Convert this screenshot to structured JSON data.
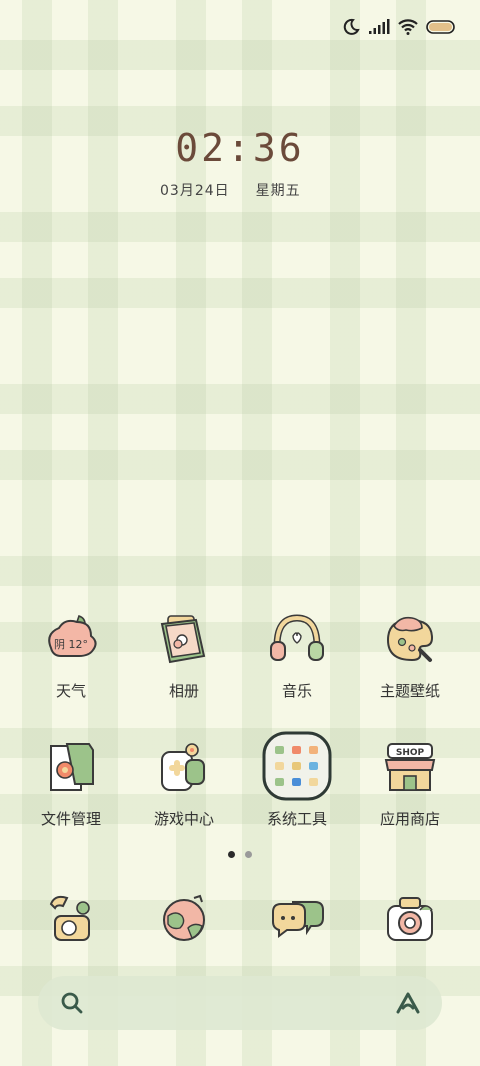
{
  "status_bar": {
    "icons": [
      "moon-icon",
      "signal-icon",
      "wifi-icon",
      "battery-icon"
    ]
  },
  "clock": {
    "time": "02:36"
  },
  "date": {
    "day": "03月24日",
    "weekday": "星期五"
  },
  "weather": {
    "temperature": "阴 12°"
  },
  "apps_row1": [
    {
      "label": "天气",
      "icon": "weather-icon"
    },
    {
      "label": "相册",
      "icon": "gallery-icon"
    },
    {
      "label": "音乐",
      "icon": "headphones-icon"
    },
    {
      "label": "主题壁纸",
      "icon": "palette-icon"
    }
  ],
  "apps_row2": [
    {
      "label": "文件管理",
      "icon": "file-manager-icon"
    },
    {
      "label": "游戏中心",
      "icon": "game-center-icon"
    },
    {
      "label": "系统工具",
      "icon": "system-tools-folder-icon"
    },
    {
      "label": "应用商店",
      "icon": "shop-icon"
    }
  ],
  "shop_sign": "SHOP",
  "page_indicator": {
    "pages": 2,
    "current": 1
  },
  "dock": [
    {
      "icon": "phone-icon"
    },
    {
      "icon": "browser-globe-icon"
    },
    {
      "icon": "messages-icon"
    },
    {
      "icon": "camera-icon"
    }
  ],
  "search_bar": {
    "left_icon": "search-icon",
    "right_icon": "assistant-icon"
  },
  "colors": {
    "accent": "#6b4a3a",
    "bubble_green": "#b9d6a4",
    "bubble_peach": "#f2b7a6"
  }
}
